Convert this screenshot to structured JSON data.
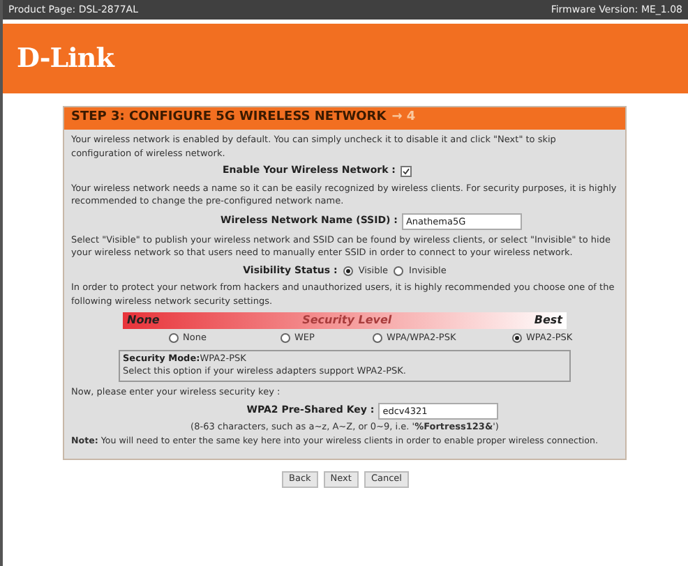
{
  "top_bar": {
    "product": "Product Page: DSL-2877AL",
    "firmware": "Firmware Version: ME_1.08"
  },
  "logo": "D-Link",
  "panel": {
    "title": "STEP 3: CONFIGURE 5G WIRELESS NETWORK",
    "step_next": "→ 4",
    "intro": "Your wireless network is enabled by default. You can simply uncheck it to disable it and click \"Next\" to skip configuration of wireless network.",
    "enable": {
      "label": "Enable Your Wireless Network :",
      "checked": true
    },
    "name_help": "Your wireless network needs a name so it can be easily recognized by wireless clients. For security purposes, it is highly recommended to change the pre-configured network name.",
    "ssid": {
      "label": "Wireless Network Name (SSID) :",
      "value": "Anathema5G"
    },
    "visibility_help": "Select \"Visible\" to publish your wireless network and SSID can be found by wireless clients, or select \"Invisible\" to hide your wireless network so that users need to manually enter SSID in order to connect to your wireless network.",
    "visibility": {
      "label": "Visibility Status :",
      "options": [
        {
          "label": "Visible",
          "selected": true
        },
        {
          "label": "Invisible",
          "selected": false
        }
      ]
    },
    "security_help": "In order to protect your network from hackers and unauthorized users, it is highly recommended you choose one of the following wireless network security settings.",
    "security_bar": {
      "low": "None",
      "title": "Security Level",
      "high": "Best"
    },
    "security_options": [
      {
        "label": "None",
        "selected": false
      },
      {
        "label": "WEP",
        "selected": false
      },
      {
        "label": "WPA/WPA2-PSK",
        "selected": false
      },
      {
        "label": "WPA2-PSK",
        "selected": true
      }
    ],
    "mode_box": {
      "label": "Security Mode:",
      "value": "WPA2-PSK",
      "description": "Select this option if your wireless adapters support WPA2-PSK."
    },
    "key_prompt": "Now, please enter your wireless security key :",
    "key": {
      "label": "WPA2 Pre-Shared Key :",
      "value": "edcv4321"
    },
    "key_hint": "(8-63 characters, such as a~z, A~Z, or 0~9, i.e. '**%Fortress123&**')",
    "note": "**Note:** You will need to enter the same key here into your wireless clients in order to enable proper wireless connection."
  },
  "buttons": [
    "Back",
    "Next",
    "Cancel"
  ]
}
